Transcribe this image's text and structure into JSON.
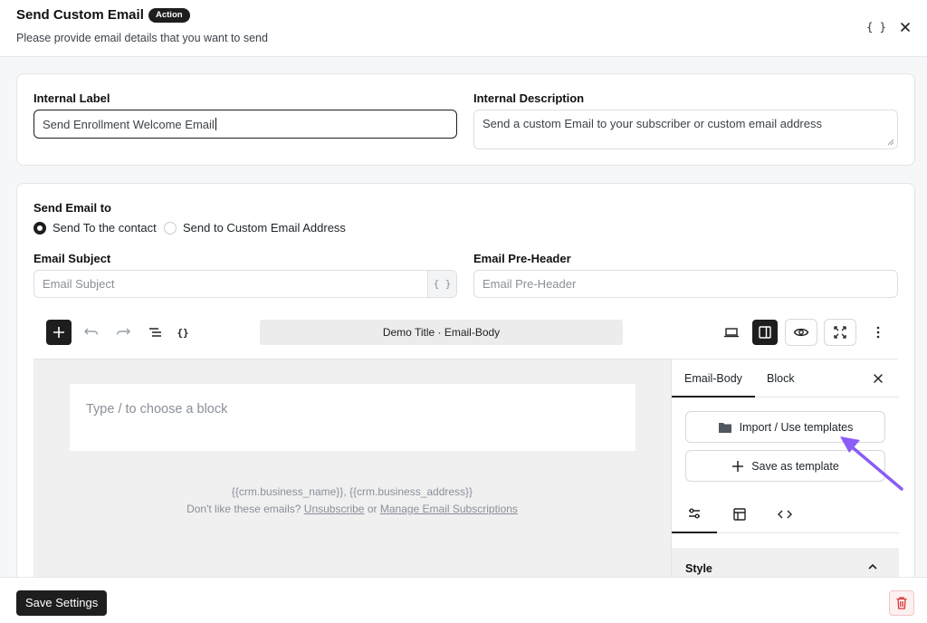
{
  "header": {
    "title": "Send Custom Email",
    "badge": "Action",
    "subtitle": "Please provide email details that you want to send",
    "braces": "{ }"
  },
  "general": {
    "internal_label": {
      "label": "Internal Label",
      "value": "Send Enrollment Welcome Email"
    },
    "internal_description": {
      "label": "Internal Description",
      "value": "Send a custom Email to your subscriber or custom email address"
    }
  },
  "email": {
    "send_to_label": "Send Email to",
    "recipient_options": [
      {
        "label": "Send To the contact",
        "selected": true
      },
      {
        "label": "Send to Custom Email Address",
        "selected": false
      }
    ],
    "subject": {
      "label": "Email Subject",
      "placeholder": "Email Subject",
      "braces": "{ }"
    },
    "preheader": {
      "label": "Email Pre-Header",
      "placeholder": "Email Pre-Header"
    }
  },
  "editor": {
    "document_title": "Demo Title · Email-Body",
    "toolbar_icons": [
      "plus-icon",
      "undo-icon",
      "redo-icon",
      "list-view-icon",
      "code-braces-icon",
      "desktop-icon",
      "sidebar-icon",
      "eye-icon",
      "fullscreen-icon",
      "more-vertical-icon"
    ],
    "block_placeholder": "Type / to choose a block",
    "footer_merge_tags": "{{crm.business_name}}, {{crm.business_address}}",
    "footer_prefix": "Don't like these emails?",
    "unsubscribe_label": "Unsubscribe",
    "or_label": "or",
    "manage_label": "Manage Email Subscriptions"
  },
  "sidebar": {
    "tabs": [
      {
        "label": "Email-Body",
        "active": true
      },
      {
        "label": "Block",
        "active": false
      }
    ],
    "import_button": "Import / Use templates",
    "save_template_button": "Save as template",
    "style_label": "Style"
  },
  "footer": {
    "save_button": "Save Settings"
  },
  "colors": {
    "accent_dark": "#1e1e1e",
    "annotation_arrow": "#8b5cf6",
    "danger": "#d63638"
  }
}
